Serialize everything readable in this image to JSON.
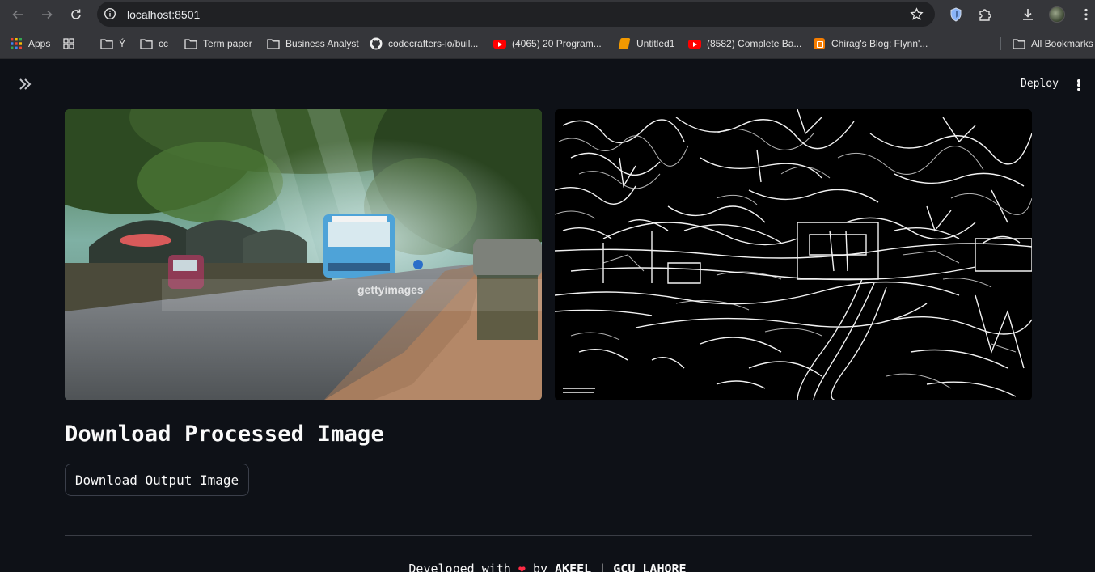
{
  "browser": {
    "url": "localhost:8501",
    "bookmarks": [
      {
        "label": "Apps",
        "icon": "apps-grid-icon"
      },
      {
        "label": "",
        "icon": "tab-groups-icon"
      },
      {
        "label": "Ý",
        "icon": "folder-icon"
      },
      {
        "label": "cc",
        "icon": "folder-icon"
      },
      {
        "label": "Term paper",
        "icon": "folder-icon"
      },
      {
        "label": "Business Analyst",
        "icon": "folder-icon"
      },
      {
        "label": "codecrafters-io/buil...",
        "icon": "github-icon"
      },
      {
        "label": "(4065) 20 Program...",
        "icon": "youtube-icon"
      },
      {
        "label": "Untitled1",
        "icon": "colab-icon"
      },
      {
        "label": "(8582) Complete Ba...",
        "icon": "youtube-icon"
      },
      {
        "label": "Chirag's Blog: Flynn'...",
        "icon": "blogger-icon"
      },
      {
        "label": "All Bookmarks",
        "icon": "folder-icon"
      }
    ]
  },
  "header": {
    "deploy_label": "Deploy"
  },
  "main": {
    "input_image_alt": "gettyimages",
    "section_title": "Download Processed Image",
    "download_button_label": "Download Output Image"
  },
  "footer": {
    "prefix": "Developed with",
    "heart": "❤",
    "by": "by",
    "author": "AKEEL",
    "sep": "|",
    "org": "GCU LAHORE"
  },
  "colors": {
    "app_background": "#0e1117",
    "browser_chrome": "#35363a",
    "heart": "#ff2b45"
  }
}
